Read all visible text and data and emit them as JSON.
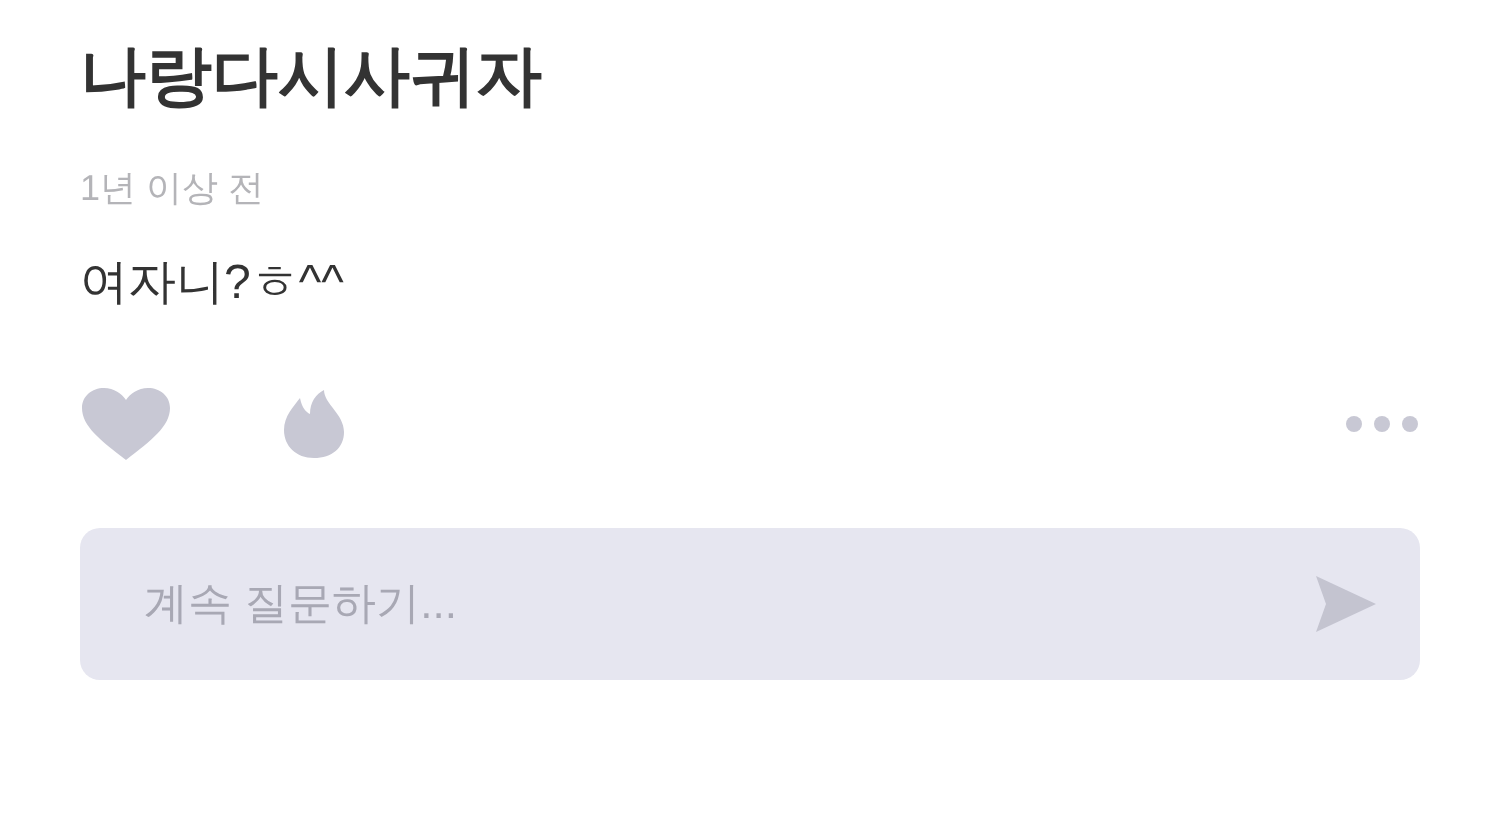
{
  "post": {
    "author": "나랑다시사귀자",
    "time": "1년 이상 전",
    "body": "여자니?ㅎ^^"
  },
  "reactions": [
    {
      "kind": "heart",
      "selected": false
    },
    {
      "kind": "fire",
      "selected": false
    }
  ],
  "reply": {
    "placeholder": "계속 질문하기..."
  }
}
